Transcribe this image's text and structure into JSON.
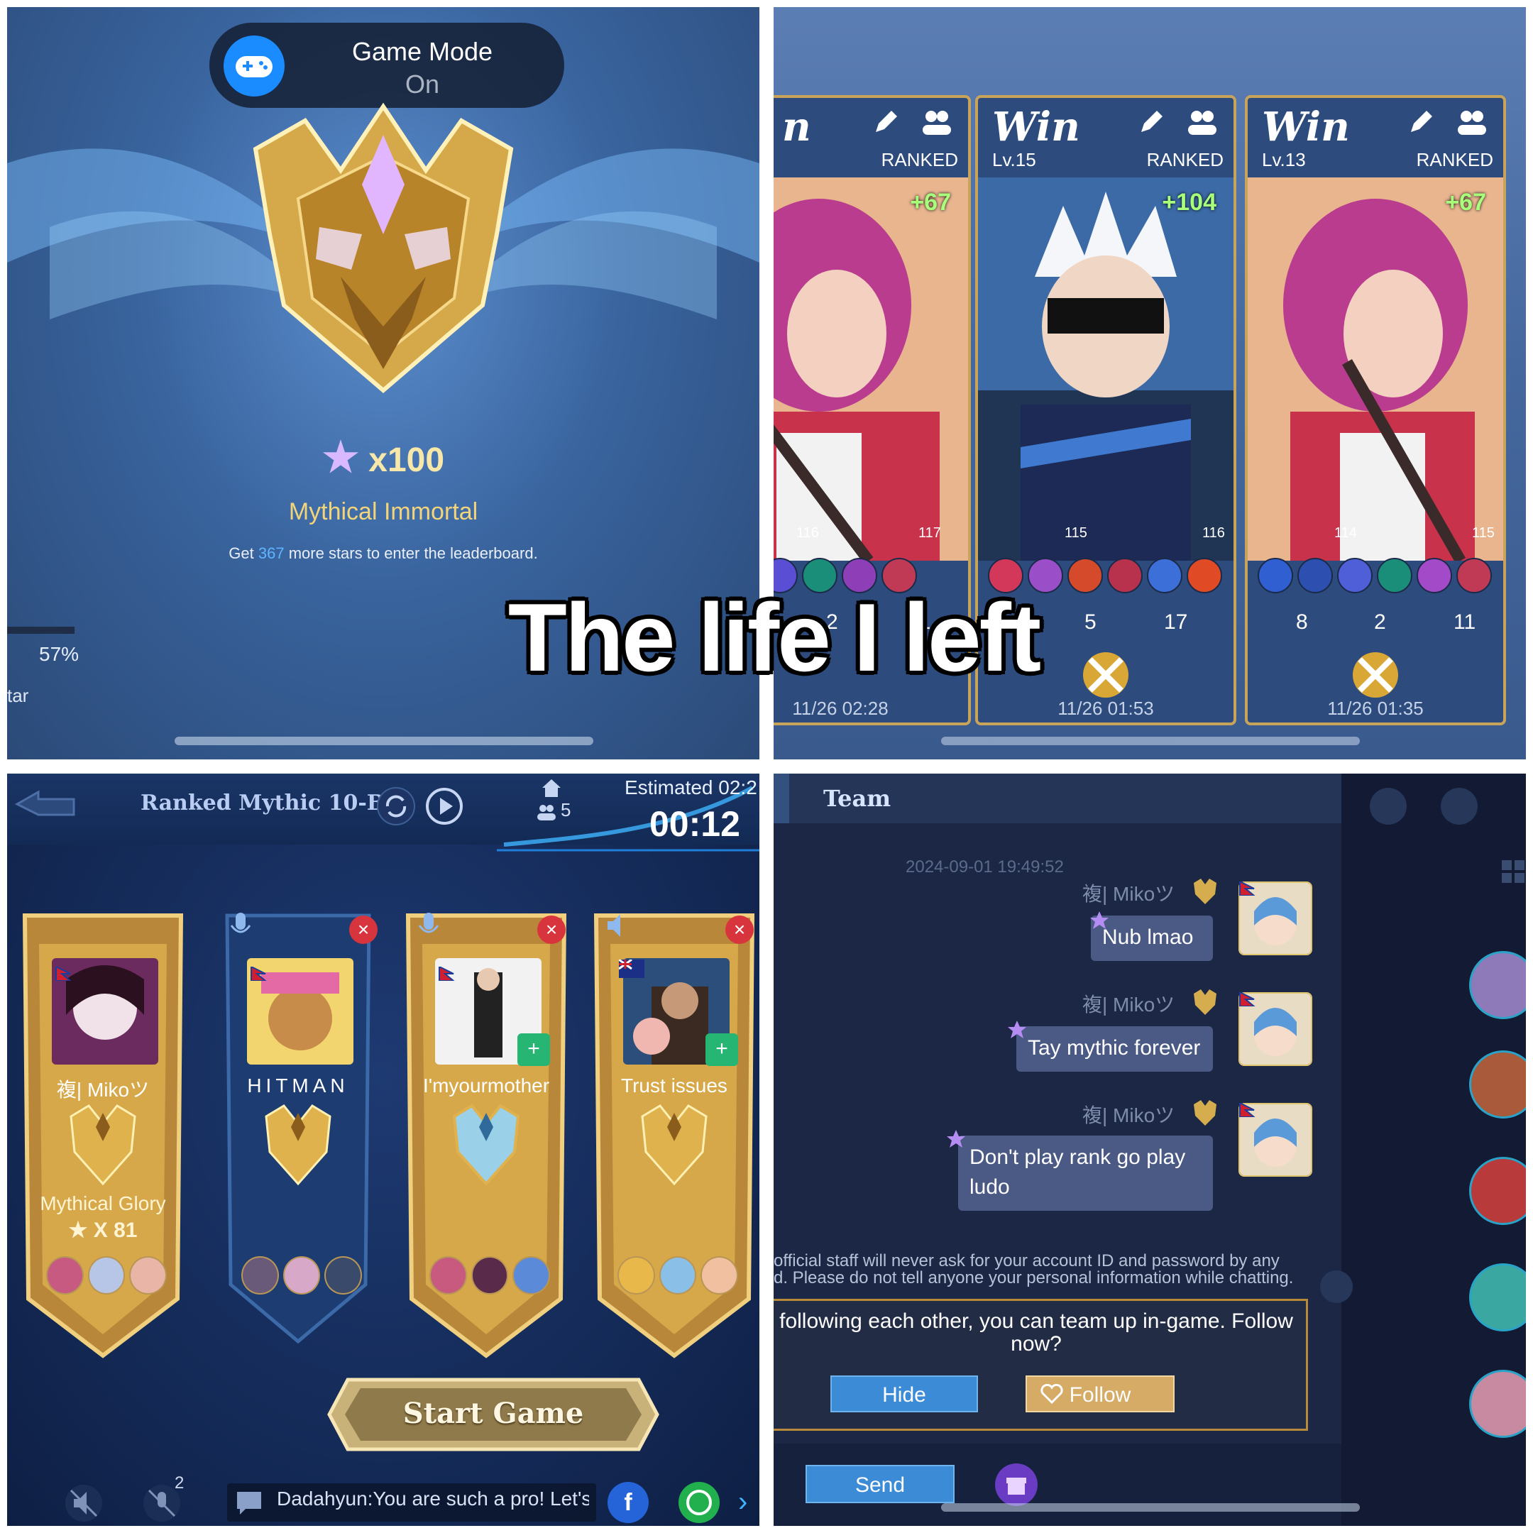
{
  "rank_screen": {
    "notification": {
      "title": "Game Mode",
      "state": "On",
      "icon": "gamepad-icon"
    },
    "star_count": "x100",
    "rank_name": "Mythical Immortal",
    "leaderboard_hint_prefix": "Get ",
    "leaderboard_hint_number": "367",
    "leaderboard_hint_suffix": " more stars to enter the leaderboard.",
    "progress_percent": "57%",
    "partial_label": "tar"
  },
  "match_history": {
    "cards": [
      {
        "result": "n",
        "level": "",
        "mode": "RANKED",
        "points": "+67",
        "star_from": "116",
        "star_to": "117",
        "kda": [
          "2",
          "11"
        ],
        "date": "11/26 02:28",
        "hero": "hero-pink-hair"
      },
      {
        "result": "Win",
        "level": "Lv.15",
        "mode": "RANKED",
        "points": "+104",
        "star_from": "115",
        "star_to": "116",
        "kda": [
          "5",
          "17"
        ],
        "date": "11/26 01:53",
        "hero": "hero-white-hair"
      },
      {
        "result": "Win",
        "level": "Lv.13",
        "mode": "RANKED",
        "points": "+67",
        "star_from": "114",
        "star_to": "115",
        "kda": [
          "8",
          "2",
          "11"
        ],
        "date": "11/26 01:35",
        "hero": "hero-pink-hair"
      }
    ]
  },
  "overlay_caption": "The life I left",
  "lobby": {
    "title": "Ranked Mythic 10-Ban",
    "party_count": "5",
    "estimated_label": "Estimated 02:2",
    "timer": "00:12",
    "players": [
      {
        "name": "複| Mikoツ",
        "rank": "Mythical Glory",
        "stars": "X 81",
        "flag": "nepal"
      },
      {
        "name": "HITMAN",
        "rank": "",
        "stars": "",
        "flag": "nepal"
      },
      {
        "name": "I'myourmother",
        "rank": "",
        "stars": "",
        "flag": "nepal"
      },
      {
        "name": "Trust issues",
        "rank": "",
        "stars": "",
        "flag": "australia"
      }
    ],
    "start_button": "Start Game",
    "muted_count": "2",
    "chat_preview": "Dadahyun:You are such a pro! Let's",
    "facebook_glyph": "f"
  },
  "team_chat": {
    "title": "Team",
    "timestamp": "2024-09-01 19:49:52",
    "messages": [
      {
        "sender": "複| Mikoツ",
        "text": "Nub lmao"
      },
      {
        "sender": "複| Mikoツ",
        "text": "Tay mythic forever"
      },
      {
        "sender": "複| Mikoツ",
        "text": "Don't play rank go play ludo"
      }
    ],
    "safety_notice_line1": "official staff will never ask for your account ID and password by any",
    "safety_notice_line2": "d. Please do not tell anyone your personal information while chatting.",
    "follow_prompt": "following each other, you can team up in-game. Follow now?",
    "hide_button": "Hide",
    "follow_button": "Follow",
    "send_button": "Send"
  },
  "colors": {
    "accent_blue": "#3b8bd6",
    "gold": "#c8a45a",
    "win_green": "#a8ff7c",
    "close_red": "#d8343d"
  }
}
